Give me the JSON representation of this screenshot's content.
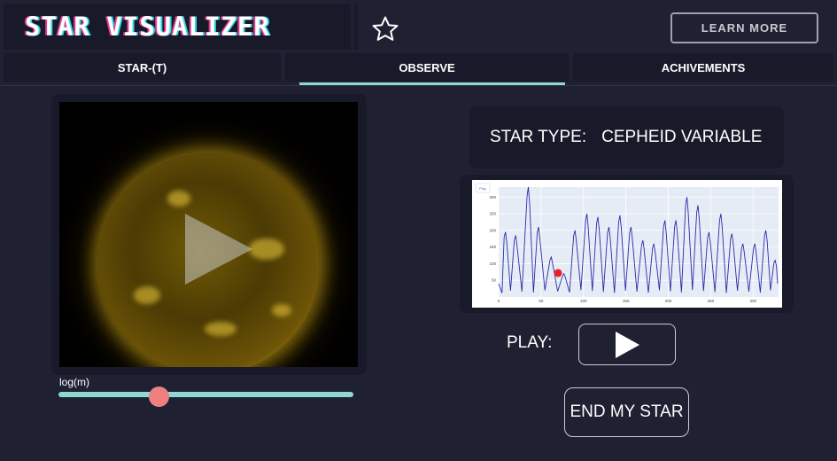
{
  "header": {
    "title": "STAR VISUALIZER",
    "star_icon": "star-outline-icon",
    "learn_more_label": "LEARN MORE"
  },
  "tabs": [
    {
      "label": "STAR-(T)",
      "active": false
    },
    {
      "label": "OBSERVE",
      "active": true
    },
    {
      "label": "ACHIVEMENTS",
      "active": false
    }
  ],
  "video": {
    "play_icon": "play-icon"
  },
  "slider": {
    "label": "log(m)",
    "value_fraction": 0.34
  },
  "star_type": {
    "label": "STAR TYPE:",
    "value": "CEPHEID VARIABLE"
  },
  "controls": {
    "play_label": "PLAY:",
    "play_icon": "play-icon",
    "end_label": "END MY STAR"
  },
  "colors": {
    "accent": "#8fd8d0",
    "thumb": "#f08080",
    "background": "#1f2132",
    "panel": "#181a29",
    "line": "#2b2ba8",
    "marker": "#e8202a"
  },
  "chart_data": {
    "type": "line",
    "modebar_label": "Play",
    "x_ticks": [
      "0",
      "50",
      "100",
      "150",
      "200",
      "250",
      "300"
    ],
    "y_ticks": [
      "50",
      "100",
      "150",
      "200",
      "250",
      "300"
    ],
    "xlim": [
      0,
      330
    ],
    "ylim": [
      0,
      330
    ],
    "grid": true,
    "peaks": [
      {
        "x": 8,
        "y": 195
      },
      {
        "x": 20,
        "y": 185
      },
      {
        "x": 35,
        "y": 330
      },
      {
        "x": 47,
        "y": 210
      },
      {
        "x": 62,
        "y": 120
      },
      {
        "x": 77,
        "y": 70
      },
      {
        "x": 90,
        "y": 200
      },
      {
        "x": 104,
        "y": 250
      },
      {
        "x": 117,
        "y": 240
      },
      {
        "x": 130,
        "y": 210
      },
      {
        "x": 143,
        "y": 245
      },
      {
        "x": 156,
        "y": 210
      },
      {
        "x": 170,
        "y": 170
      },
      {
        "x": 183,
        "y": 160
      },
      {
        "x": 196,
        "y": 230
      },
      {
        "x": 209,
        "y": 230
      },
      {
        "x": 222,
        "y": 300
      },
      {
        "x": 235,
        "y": 275
      },
      {
        "x": 248,
        "y": 195
      },
      {
        "x": 262,
        "y": 250
      },
      {
        "x": 275,
        "y": 190
      },
      {
        "x": 288,
        "y": 160
      },
      {
        "x": 302,
        "y": 160
      },
      {
        "x": 315,
        "y": 200
      },
      {
        "x": 326,
        "y": 110
      }
    ],
    "marker": {
      "x": 70,
      "y": 72
    }
  }
}
